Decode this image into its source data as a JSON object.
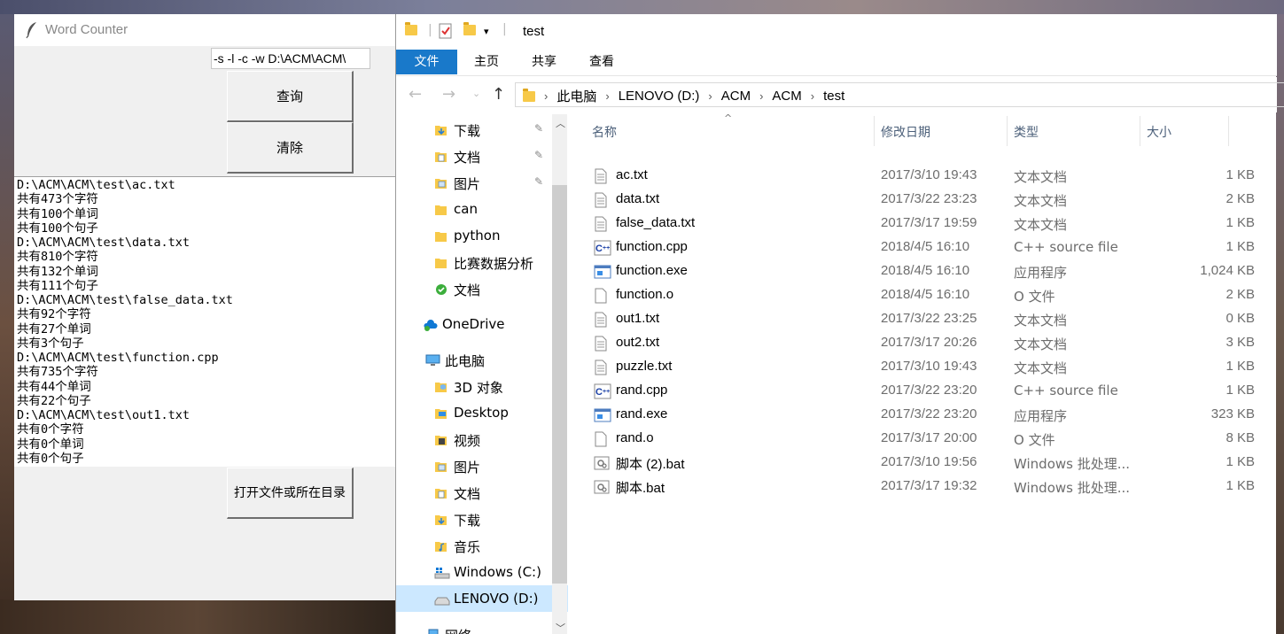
{
  "word_counter": {
    "title": "Word Counter",
    "command_input": "-s -l -c -w D:\\ACM\\ACM\\",
    "query_button": "查询",
    "clear_button": "清除",
    "open_button": "打开文件或所在目录",
    "output_lines": [
      "D:\\ACM\\ACM\\test\\ac.txt",
      "共有473个字符",
      "共有100个单词",
      "共有100个句子",
      "D:\\ACM\\ACM\\test\\data.txt",
      "共有810个字符",
      "共有132个单词",
      "共有111个句子",
      "D:\\ACM\\ACM\\test\\false_data.txt",
      "共有92个字符",
      "共有27个单词",
      "共有3个句子",
      "D:\\ACM\\ACM\\test\\function.cpp",
      "共有735个字符",
      "共有44个单词",
      "共有22个句子",
      "D:\\ACM\\ACM\\test\\out1.txt",
      "共有0个字符",
      "共有0个单词",
      "共有0个句子"
    ]
  },
  "explorer": {
    "title": "test",
    "ribbon_tabs": [
      "文件",
      "主页",
      "共享",
      "查看"
    ],
    "breadcrumb": [
      "此电脑",
      "LENOVO (D:)",
      "ACM",
      "ACM",
      "test"
    ],
    "nav_items": [
      {
        "label": "下载",
        "icon": "download-folder-icon",
        "pinned": true
      },
      {
        "label": "文档",
        "icon": "documents-folder-icon",
        "pinned": true
      },
      {
        "label": "图片",
        "icon": "pictures-folder-icon",
        "pinned": true
      },
      {
        "label": "can",
        "icon": "folder-icon",
        "pinned": false
      },
      {
        "label": "python",
        "icon": "folder-icon",
        "pinned": false
      },
      {
        "label": "比赛数据分析",
        "icon": "folder-icon",
        "pinned": false
      },
      {
        "label": "文档",
        "icon": "synced-folder-icon",
        "pinned": false
      },
      {
        "label": "OneDrive",
        "icon": "onedrive-icon",
        "pinned": false
      },
      {
        "label": "此电脑",
        "icon": "this-pc-icon",
        "pinned": false
      },
      {
        "label": "3D 对象",
        "icon": "3d-objects-icon",
        "pinned": false
      },
      {
        "label": "Desktop",
        "icon": "desktop-folder-icon",
        "pinned": false
      },
      {
        "label": "视频",
        "icon": "videos-folder-icon",
        "pinned": false
      },
      {
        "label": "图片",
        "icon": "pictures-folder-icon",
        "pinned": false
      },
      {
        "label": "文档",
        "icon": "documents-folder-icon",
        "pinned": false
      },
      {
        "label": "下载",
        "icon": "download-folder-icon",
        "pinned": false
      },
      {
        "label": "音乐",
        "icon": "music-folder-icon",
        "pinned": false
      },
      {
        "label": "Windows (C:)",
        "icon": "windows-drive-icon",
        "pinned": false
      },
      {
        "label": "LENOVO (D:)",
        "icon": "drive-icon",
        "pinned": false,
        "selected": true
      },
      {
        "label": "网络",
        "icon": "network-icon",
        "pinned": false
      }
    ],
    "columns": [
      "名称",
      "修改日期",
      "类型",
      "大小"
    ],
    "files": [
      {
        "name": "ac.txt",
        "date": "2017/3/10 19:43",
        "type": "文本文档",
        "size": "1 KB",
        "icon": "text-file-icon"
      },
      {
        "name": "data.txt",
        "date": "2017/3/22 23:23",
        "type": "文本文档",
        "size": "2 KB",
        "icon": "text-file-icon"
      },
      {
        "name": "false_data.txt",
        "date": "2017/3/17 19:59",
        "type": "文本文档",
        "size": "1 KB",
        "icon": "text-file-icon"
      },
      {
        "name": "function.cpp",
        "date": "2018/4/5 16:10",
        "type": "C++ source file",
        "size": "1 KB",
        "icon": "cpp-file-icon"
      },
      {
        "name": "function.exe",
        "date": "2018/4/5 16:10",
        "type": "应用程序",
        "size": "1,024 KB",
        "icon": "exe-file-icon"
      },
      {
        "name": "function.o",
        "date": "2018/4/5 16:10",
        "type": "O 文件",
        "size": "2 KB",
        "icon": "blank-file-icon"
      },
      {
        "name": "out1.txt",
        "date": "2017/3/22 23:25",
        "type": "文本文档",
        "size": "0 KB",
        "icon": "text-file-icon"
      },
      {
        "name": "out2.txt",
        "date": "2017/3/17 20:26",
        "type": "文本文档",
        "size": "3 KB",
        "icon": "text-file-icon"
      },
      {
        "name": "puzzle.txt",
        "date": "2017/3/10 19:43",
        "type": "文本文档",
        "size": "1 KB",
        "icon": "text-file-icon"
      },
      {
        "name": "rand.cpp",
        "date": "2017/3/22 23:20",
        "type": "C++ source file",
        "size": "1 KB",
        "icon": "cpp-file-icon"
      },
      {
        "name": "rand.exe",
        "date": "2017/3/22 23:20",
        "type": "应用程序",
        "size": "323 KB",
        "icon": "exe-file-icon"
      },
      {
        "name": "rand.o",
        "date": "2017/3/17 20:00",
        "type": "O 文件",
        "size": "8 KB",
        "icon": "blank-file-icon"
      },
      {
        "name": "脚本 (2).bat",
        "date": "2017/3/10 19:56",
        "type": "Windows 批处理...",
        "size": "1 KB",
        "icon": "bat-file-icon"
      },
      {
        "name": "脚本.bat",
        "date": "2017/3/17 19:32",
        "type": "Windows 批处理...",
        "size": "1 KB",
        "icon": "bat-file-icon"
      }
    ]
  }
}
